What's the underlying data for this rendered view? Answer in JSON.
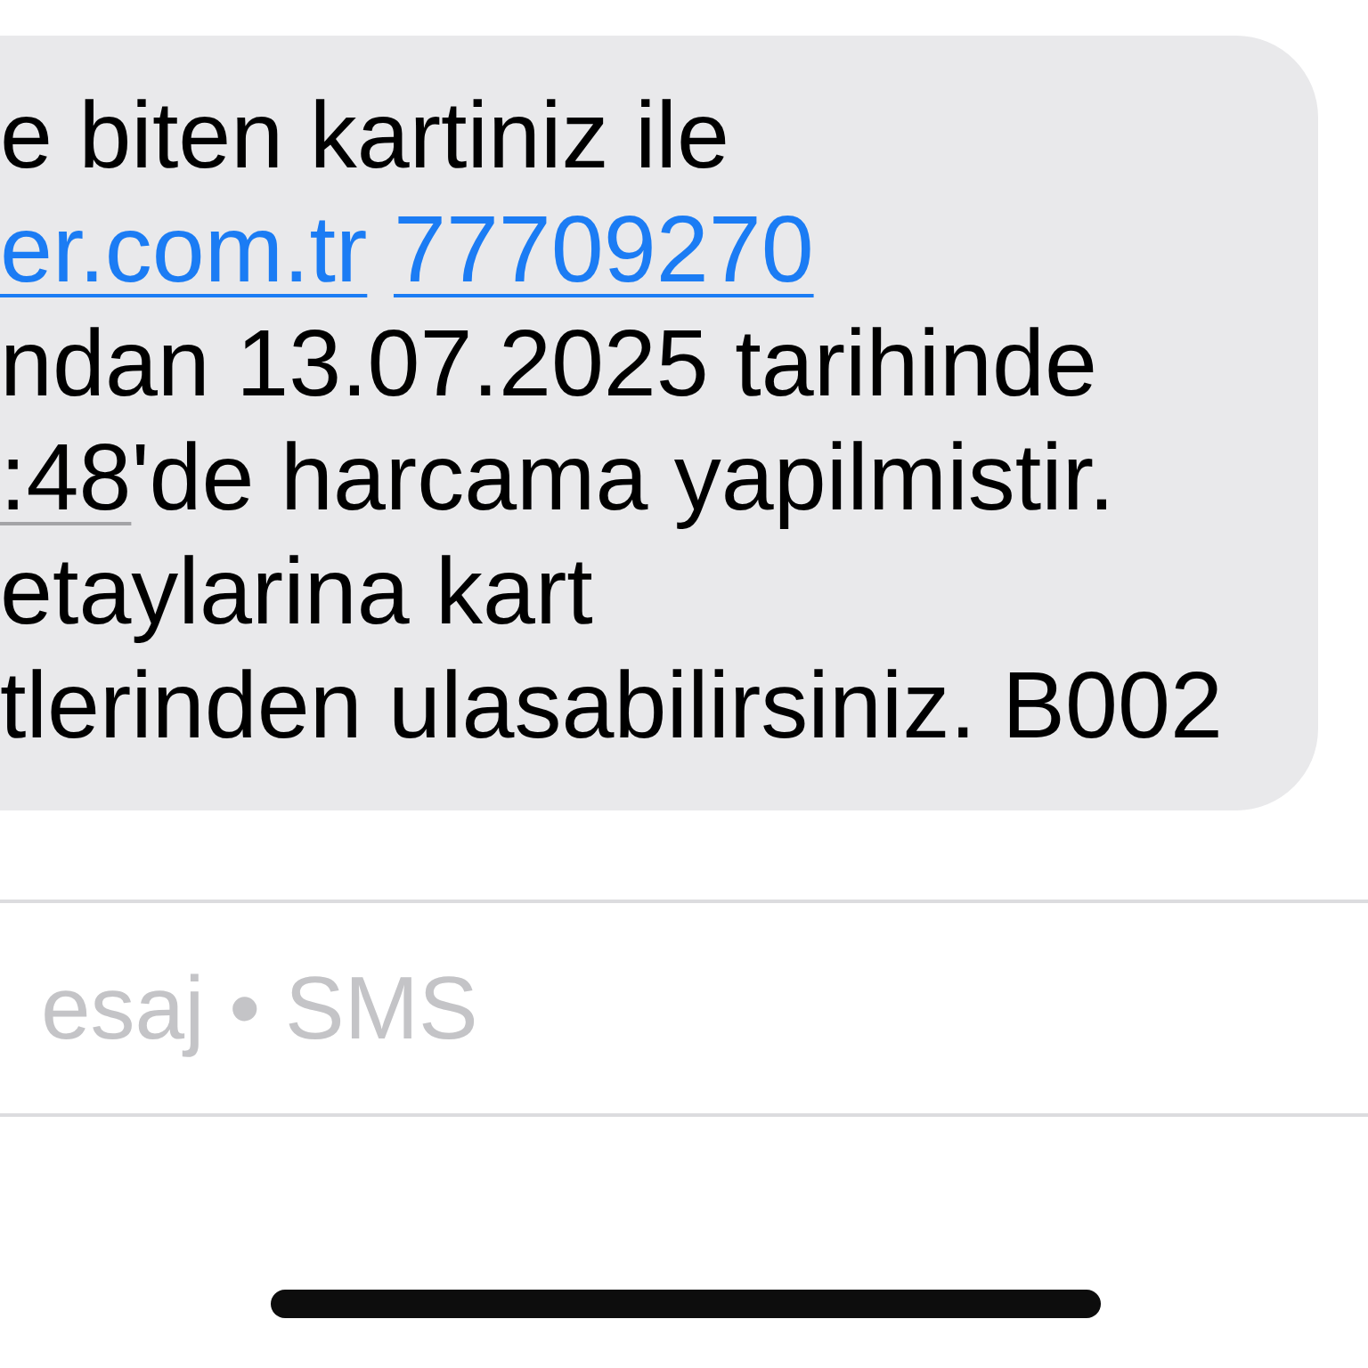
{
  "message": {
    "lines": [
      [
        {
          "kind": "text",
          "text": "e biten kartiniz ile"
        }
      ],
      [
        {
          "kind": "link",
          "text": "er.com.tr"
        },
        {
          "kind": "link",
          "text": "77709270"
        }
      ],
      [
        {
          "kind": "text",
          "text": "ndan 13.07.2025 tarihinde"
        }
      ],
      [
        {
          "kind": "time",
          "text": ":48"
        },
        {
          "kind": "text",
          "text": "'de harcama yapilmistir."
        }
      ],
      [
        {
          "kind": "text",
          "text": "etaylarina kart"
        }
      ],
      [
        {
          "kind": "text",
          "text": "tlerinden ulasabilirsiniz. B002"
        }
      ]
    ]
  },
  "compose": {
    "placeholder": "esaj • SMS"
  }
}
